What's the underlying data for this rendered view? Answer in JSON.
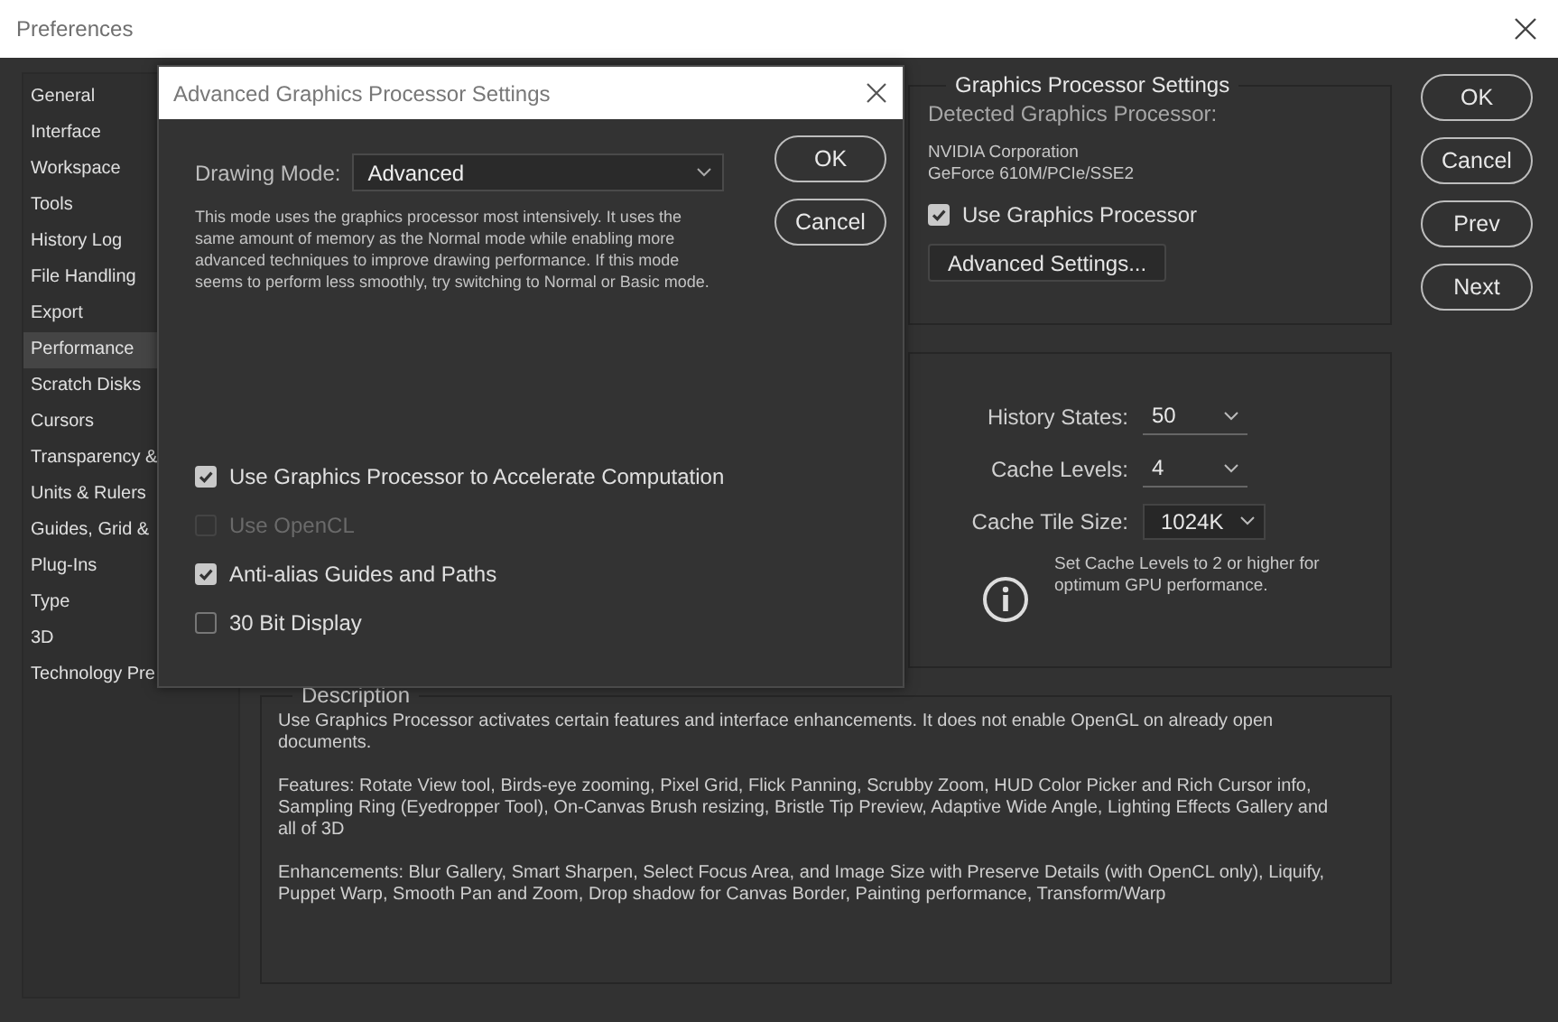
{
  "window": {
    "title": "Preferences"
  },
  "sidebar": {
    "items": [
      {
        "label": "General",
        "selected": false
      },
      {
        "label": "Interface",
        "selected": false
      },
      {
        "label": "Workspace",
        "selected": false
      },
      {
        "label": "Tools",
        "selected": false
      },
      {
        "label": "History Log",
        "selected": false
      },
      {
        "label": "File Handling",
        "selected": false
      },
      {
        "label": "Export",
        "selected": false
      },
      {
        "label": "Performance",
        "selected": true
      },
      {
        "label": "Scratch Disks",
        "selected": false
      },
      {
        "label": "Cursors",
        "selected": false
      },
      {
        "label": "Transparency &",
        "selected": false
      },
      {
        "label": "Units & Rulers",
        "selected": false
      },
      {
        "label": "Guides, Grid &",
        "selected": false
      },
      {
        "label": "Plug-Ins",
        "selected": false
      },
      {
        "label": "Type",
        "selected": false
      },
      {
        "label": "3D",
        "selected": false
      },
      {
        "label": "Technology Pre",
        "selected": false
      }
    ]
  },
  "graphics_processor": {
    "title": "Graphics Processor Settings",
    "detected_label": "Detected Graphics Processor:",
    "gpu_lines": [
      "NVIDIA Corporation",
      "GeForce 610M/PCIe/SSE2"
    ],
    "use_gpu": {
      "label": "Use Graphics Processor",
      "checked": true
    },
    "advanced_button": "Advanced Settings..."
  },
  "history": {
    "fields": [
      {
        "label": "History States:",
        "value": "50",
        "kind": "underline"
      },
      {
        "label": "Cache Levels:",
        "value": "4",
        "kind": "underline"
      },
      {
        "label": "Cache Tile Size:",
        "value": "1024K",
        "kind": "boxed"
      }
    ],
    "note": "Set Cache Levels to 2 or higher for optimum GPU performance."
  },
  "description": {
    "title": "Description",
    "paragraphs": [
      "Use Graphics Processor activates certain features and interface enhancements. It does not enable OpenGL on already open documents.",
      "Features: Rotate View tool, Birds-eye zooming, Pixel Grid, Flick Panning, Scrubby Zoom, HUD Color Picker and Rich Cursor info, Sampling Ring (Eyedropper Tool), On-Canvas Brush resizing, Bristle Tip Preview, Adaptive Wide Angle, Lighting Effects Gallery and all of 3D",
      "Enhancements: Blur Gallery, Smart Sharpen, Select Focus Area, and Image Size with Preserve Details (with OpenCL only), Liquify, Puppet Warp, Smooth Pan and Zoom, Drop shadow for Canvas Border, Painting performance, Transform/Warp"
    ]
  },
  "buttons": [
    "OK",
    "Cancel",
    "Prev",
    "Next"
  ],
  "dialog": {
    "title": "Advanced Graphics Processor Settings",
    "drawing_mode": {
      "label": "Drawing Mode:",
      "value": "Advanced"
    },
    "explanation": "This mode uses the graphics processor most intensively.  It uses the same amount of memory as the Normal mode while enabling more advanced techniques to improve drawing performance.  If this mode seems to perform less smoothly, try switching to Normal or Basic mode.",
    "options": [
      {
        "label": "Use Graphics Processor to Accelerate Computation",
        "checked": true,
        "disabled": false
      },
      {
        "label": "Use OpenCL",
        "checked": false,
        "disabled": true
      },
      {
        "label": "Anti-alias Guides and Paths",
        "checked": true,
        "disabled": false
      },
      {
        "label": "30 Bit Display",
        "checked": false,
        "disabled": false
      }
    ],
    "buttons": [
      "OK",
      "Cancel"
    ]
  }
}
